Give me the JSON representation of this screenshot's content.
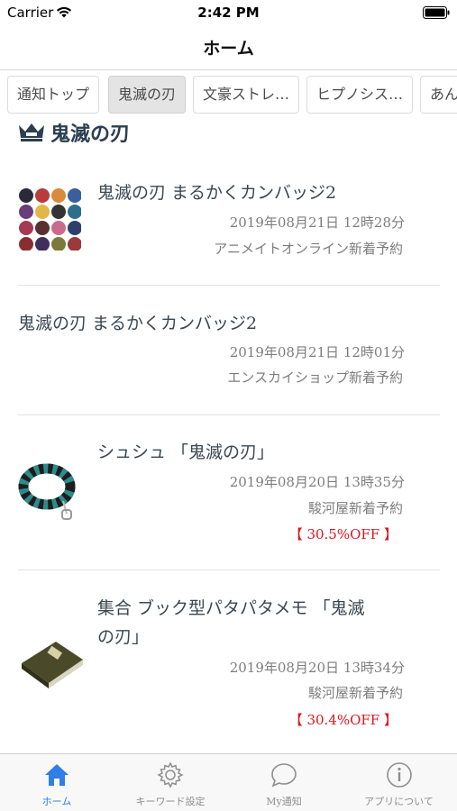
{
  "status_bar": {
    "carrier": "Carrier",
    "time": "2:42 PM",
    "icons": [
      "wifi-icon",
      "battery-icon"
    ]
  },
  "nav": {
    "title": "ホーム"
  },
  "tabs": [
    {
      "label": "通知トップ",
      "active": false
    },
    {
      "label": "鬼滅の刃",
      "active": true
    },
    {
      "label": "文豪ストレ…",
      "active": false
    },
    {
      "label": "ヒプノシス…",
      "active": false
    },
    {
      "label": "あん",
      "active": false
    }
  ],
  "section": {
    "title": "鬼滅の刃",
    "icon": "crown-icon"
  },
  "items": [
    {
      "title": "鬼滅の刃 まるかくカンバッジ2",
      "date": "2019年08月21日 12時28分",
      "source": "アニメイトオンライン新着予約",
      "thumbnail": "badge-grid-thumbnail"
    },
    {
      "title": "鬼滅の刃 まるかくカンバッジ2",
      "date": "2019年08月21日 12時01分",
      "source": "エンスカイショップ新着予約"
    },
    {
      "title": "シュシュ 「鬼滅の刃」",
      "date": "2019年08月20日 13時35分",
      "source": "駿河屋新着予約",
      "discount": "【 30.5%OFF 】",
      "thumbnail": "scrunchie-thumbnail"
    },
    {
      "title_line1": "集合 ブック型パタパタメモ 「鬼滅",
      "title_line2": "の刃」",
      "date": "2019年08月20日 13時34分",
      "source": "駿河屋新着予約",
      "discount": "【 30.4%OFF 】",
      "thumbnail": "book-memo-thumbnail"
    }
  ],
  "tab_bar": [
    {
      "label": "ホーム",
      "icon": "home-icon",
      "active": true
    },
    {
      "label": "キーワード設定",
      "icon": "gear-icon",
      "active": false
    },
    {
      "label": "My通知",
      "icon": "chat-bubble-icon",
      "active": false
    },
    {
      "label": "アプリについて",
      "icon": "info-icon",
      "active": false
    }
  ],
  "colors": {
    "accent": "#2f7fe6",
    "discount": "#e0141e",
    "title_text": "#3a4752",
    "section_title": "#2c3e50"
  }
}
